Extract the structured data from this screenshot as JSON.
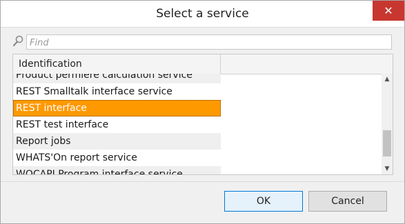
{
  "dialog": {
    "title": "Select a service",
    "close_label": "✕"
  },
  "search": {
    "placeholder": "Find",
    "value": ""
  },
  "grid": {
    "column_header": "Identification",
    "rows": [
      "Product permiere calculation service",
      "REST Smalltalk interface service",
      "REST interface",
      "REST test interface",
      "Report jobs",
      "WHATS'On report service",
      "WOCAPI Program interface service"
    ],
    "selected_index": 2,
    "scroll_up_glyph": "▲",
    "scroll_down_glyph": "▼"
  },
  "buttons": {
    "ok_label": "OK",
    "cancel_label": "Cancel"
  },
  "colors": {
    "selection": "#ff9900",
    "close_button": "#c7372f"
  }
}
